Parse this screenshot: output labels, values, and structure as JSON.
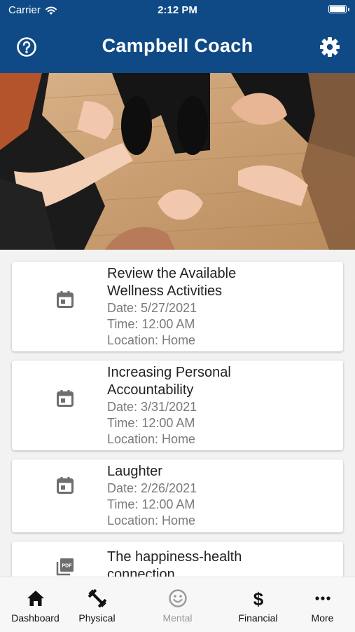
{
  "status_bar": {
    "carrier": "Carrier",
    "time": "2:12 PM"
  },
  "header": {
    "title": "Campbell Coach"
  },
  "items": [
    {
      "title_line1": "Review the Available",
      "title_line2": "Wellness Activities",
      "date": "Date: 5/27/2021",
      "time": "Time: 12:00 AM",
      "location": "Location: Home",
      "icon": "calendar-icon"
    },
    {
      "title_line1": "Increasing Personal",
      "title_line2": "Accountability",
      "date": "Date: 3/31/2021",
      "time": "Time: 12:00 AM",
      "location": "Location: Home",
      "icon": "calendar-icon"
    },
    {
      "title_line1": "Laughter",
      "date": "Date: 2/26/2021",
      "time": "Time: 12:00 AM",
      "location": "Location: Home",
      "icon": "calendar-icon"
    },
    {
      "title_line1": "The happiness-health",
      "title_line2": "connection",
      "icon": "pdf-icon"
    }
  ],
  "tabs": [
    {
      "label": "Dashboard",
      "icon": "home-icon"
    },
    {
      "label": "Physical",
      "icon": "dumbbell-icon"
    },
    {
      "label": "Mental",
      "icon": "smiley-icon"
    },
    {
      "label": "Financial",
      "icon": "dollar-icon"
    },
    {
      "label": "More",
      "icon": "more-icon"
    }
  ],
  "colors": {
    "header_bg": "#0f4a86",
    "inactive_tab": "#9a9a9a",
    "icon_gray": "#6e6e6e"
  }
}
